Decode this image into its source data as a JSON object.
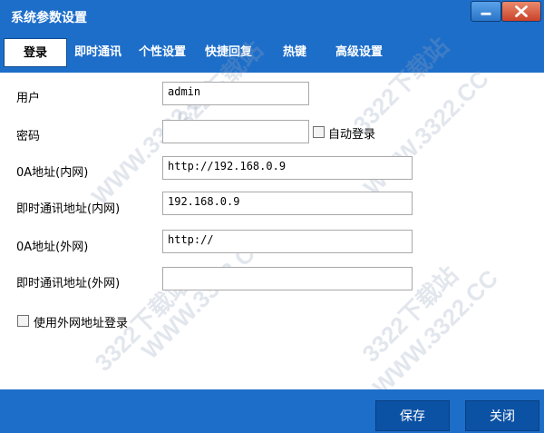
{
  "window": {
    "title": "系统参数设置"
  },
  "tabs": [
    {
      "label": "登录",
      "active": true
    },
    {
      "label": "即时通讯",
      "active": false
    },
    {
      "label": "个性设置",
      "active": false
    },
    {
      "label": "快捷回复",
      "active": false
    },
    {
      "label": "热键",
      "active": false
    },
    {
      "label": "高级设置",
      "active": false
    }
  ],
  "form": {
    "user_label": "用户",
    "user_value": "admin",
    "password_label": "密码",
    "password_value": "",
    "auto_login_label": "自动登录",
    "auto_login_checked": false,
    "oa_internal_label": "0A地址(内网)",
    "oa_internal_value": "http://192.168.0.9",
    "im_internal_label": "即时通讯地址(内网)",
    "im_internal_value": "192.168.0.9",
    "oa_external_label": "0A地址(外网)",
    "oa_external_value": "http://",
    "im_external_label": "即时通讯地址(外网)",
    "im_external_value": "",
    "use_external_label": "使用外网地址登录",
    "use_external_checked": false
  },
  "footer": {
    "save_label": "保存",
    "close_label": "关闭"
  },
  "watermark": {
    "text": "WWW.3322.CC",
    "brand": "3322下载站"
  },
  "colors": {
    "chrome_blue": "#1d6ec9",
    "button_blue": "#0c52a4"
  }
}
